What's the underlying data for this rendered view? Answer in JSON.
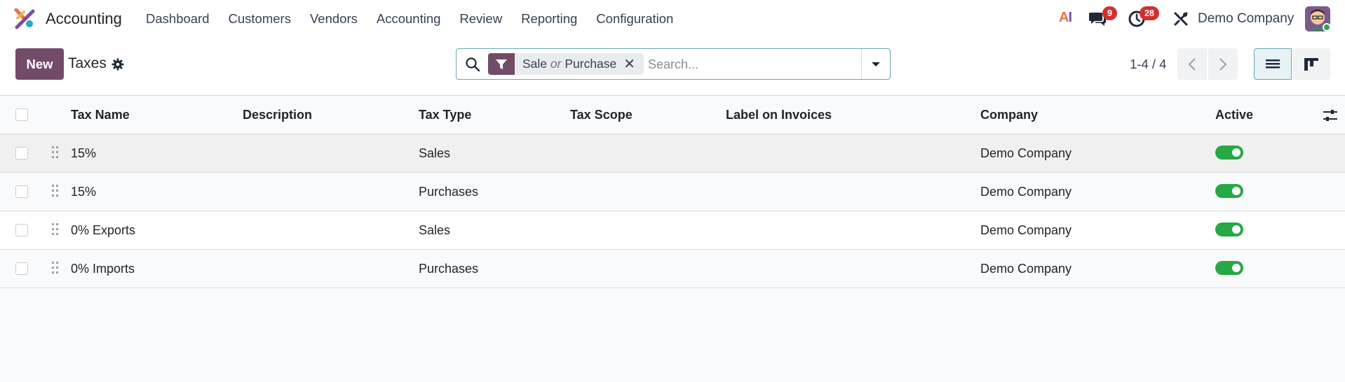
{
  "app": {
    "name": "Accounting"
  },
  "menu": [
    "Dashboard",
    "Customers",
    "Vendors",
    "Accounting",
    "Review",
    "Reporting",
    "Configuration"
  ],
  "systray": {
    "ai_label_a": "A",
    "ai_label_i": "I",
    "messages_count": "9",
    "activities_count": "28",
    "company": "Demo Company"
  },
  "control_panel": {
    "new_label": "New",
    "title": "Taxes"
  },
  "search": {
    "facet_value_1": "Sale",
    "facet_separator": "or",
    "facet_value_2": "Purchase",
    "facet_remove": "✕",
    "placeholder": "Search..."
  },
  "pager": {
    "value": "1-4 / 4"
  },
  "table": {
    "columns": [
      "Tax Name",
      "Description",
      "Tax Type",
      "Tax Scope",
      "Label on Invoices",
      "Company",
      "Active"
    ],
    "rows": [
      {
        "name": "15%",
        "description": "",
        "type": "Sales",
        "scope": "",
        "label": "",
        "company": "Demo Company",
        "active": true
      },
      {
        "name": "15%",
        "description": "",
        "type": "Purchases",
        "scope": "",
        "label": "",
        "company": "Demo Company",
        "active": true
      },
      {
        "name": "0% Exports",
        "description": "",
        "type": "Sales",
        "scope": "",
        "label": "",
        "company": "Demo Company",
        "active": true
      },
      {
        "name": "0% Imports",
        "description": "",
        "type": "Purchases",
        "scope": "",
        "label": "",
        "company": "Demo Company",
        "active": true
      }
    ]
  },
  "colors": {
    "brand": "#714b67",
    "toggle_active": "#28a745",
    "badge": "#d32f2f",
    "search_border": "#6aa6b3"
  }
}
